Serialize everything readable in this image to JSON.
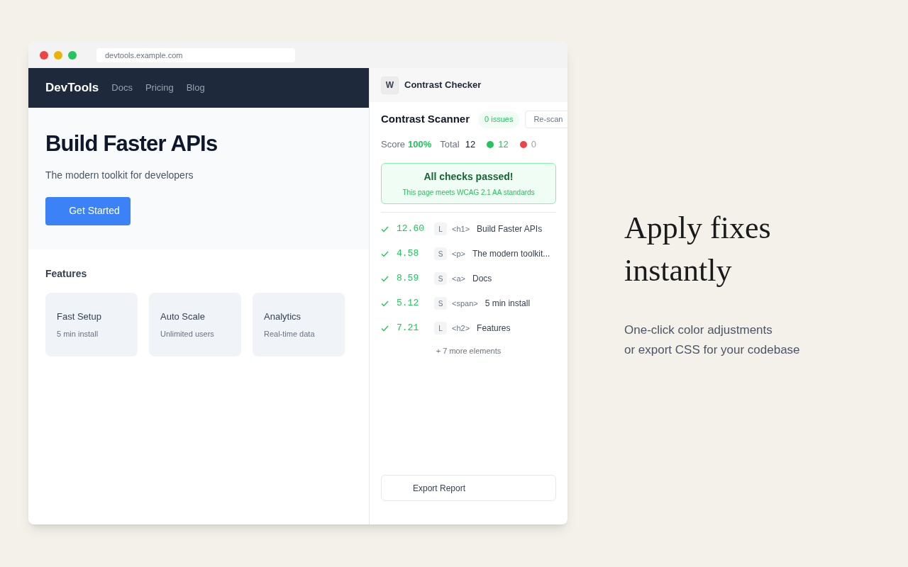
{
  "browser": {
    "url": "devtools.example.com"
  },
  "site": {
    "brand": "DevTools",
    "nav": [
      "Docs",
      "Pricing",
      "Blog"
    ],
    "hero_title": "Build Faster APIs",
    "hero_subtitle": "The modern toolkit for developers",
    "cta": "Get Started",
    "features_title": "Features",
    "features": [
      {
        "title": "Fast Setup",
        "subtitle": "5 min install"
      },
      {
        "title": "Auto Scale",
        "subtitle": "Unlimited users"
      },
      {
        "title": "Analytics",
        "subtitle": "Real-time data"
      }
    ]
  },
  "panel": {
    "logo": "W",
    "title": "Contrast Checker",
    "scanner_title": "Contrast Scanner",
    "issues": "0 issues",
    "rescan": "Re-scan",
    "score_label": "Score",
    "score": "100%",
    "total_label": "Total",
    "total": "12",
    "counts": [
      {
        "value": "12",
        "color": "#22c55e"
      },
      {
        "value": "0",
        "color": "#ef4444"
      }
    ],
    "banner": {
      "title": "All checks passed!",
      "subtitle": "This page meets WCAG 2.1 AA standards"
    },
    "results": [
      {
        "passed": true,
        "ratio": "12.60",
        "size": "L",
        "tag": "<h1>",
        "text": "Build Faster APIs"
      },
      {
        "passed": true,
        "ratio": "4.58",
        "size": "S",
        "tag": "<p>",
        "text": "The modern toolkit..."
      },
      {
        "passed": true,
        "ratio": "8.59",
        "size": "S",
        "tag": "<a>",
        "text": "Docs"
      },
      {
        "passed": true,
        "ratio": "5.12",
        "size": "S",
        "tag": "<span>",
        "text": "5 min install"
      },
      {
        "passed": true,
        "ratio": "7.21",
        "size": "L",
        "tag": "<h2>",
        "text": "Features"
      }
    ],
    "more": "+ 7 more elements",
    "export": "Export Report"
  },
  "promo": {
    "title_lines": [
      "Apply fixes",
      "instantly"
    ],
    "body_lines": [
      "One-click color adjustments",
      "or export CSS for your codebase"
    ]
  }
}
